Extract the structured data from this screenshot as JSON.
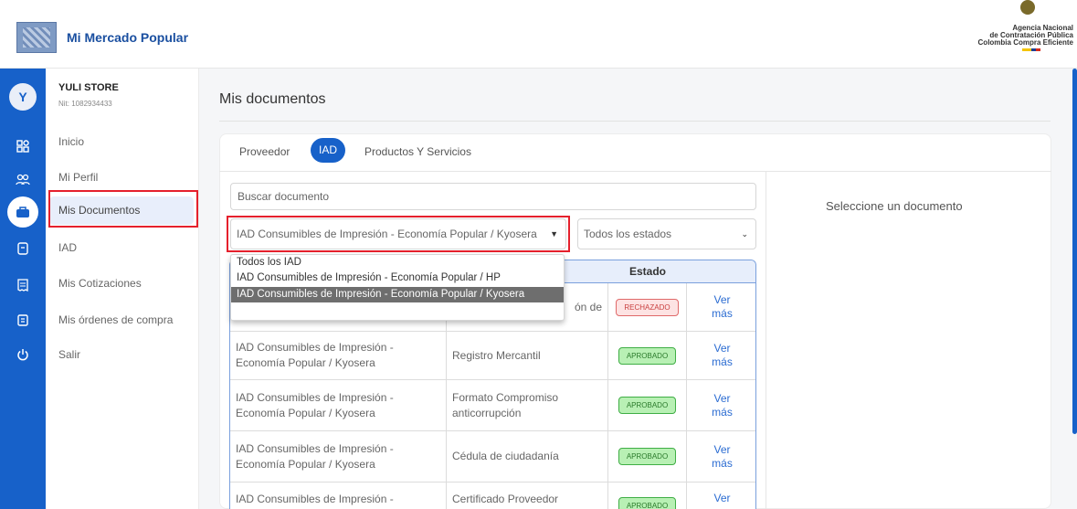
{
  "header": {
    "app_name": "Mi Mercado Popular",
    "agency_line1": "Agencia Nacional",
    "agency_line2": "de Contratación Pública",
    "agency_line3": "Colombia Compra Eficiente"
  },
  "rail": {
    "avatar_letter": "Y",
    "icons": [
      "grid-icon",
      "users-icon",
      "briefcase-icon",
      "document-icon",
      "receipt-icon",
      "clipboard-icon",
      "power-icon"
    ]
  },
  "sidebar": {
    "store_name": "YULI STORE",
    "store_nit": "Nit: 1082934433",
    "items": [
      {
        "label": "Inicio"
      },
      {
        "label": "Mi Perfil"
      },
      {
        "label": "Mis Documentos"
      },
      {
        "label": "IAD"
      },
      {
        "label": "Mis Cotizaciones"
      },
      {
        "label": "Mis órdenes de compra"
      },
      {
        "label": "Salir"
      }
    ],
    "active_index": 2
  },
  "main": {
    "title": "Mis documentos",
    "tabs": [
      {
        "label": "Proveedor"
      },
      {
        "label": "IAD"
      },
      {
        "label": "Productos Y Servicios"
      }
    ],
    "active_tab": 1,
    "search_placeholder": "Buscar documento",
    "iad_select_value": "IAD Consumibles de Impresión - Economía Popular / Kyosera",
    "state_select_value": "Todos los estados",
    "dropdown_options": [
      "Todos los IAD",
      "IAD Consumibles de Impresión - Economía Popular / HP",
      "IAD Consumibles de Impresión - Economía Popular / Kyosera"
    ],
    "dropdown_selected_index": 2,
    "empty_message": "Seleccione un documento"
  },
  "table": {
    "headers": [
      "",
      "",
      "Estado",
      ""
    ],
    "rows": [
      {
        "iad": "",
        "document": "ón de",
        "status": "RECHAZADO",
        "status_type": "rejected",
        "action": "Ver más"
      },
      {
        "iad": "IAD Consumibles de Impresión - Economía Popular / Kyosera",
        "document": "Registro Mercantil",
        "status": "APROBADO",
        "status_type": "approved",
        "action": "Ver más"
      },
      {
        "iad": "IAD Consumibles de Impresión - Economía Popular / Kyosera",
        "document": "Formato Compromiso anticorrupción",
        "status": "APROBADO",
        "status_type": "approved",
        "action": "Ver más"
      },
      {
        "iad": "IAD Consumibles de Impresión - Economía Popular / Kyosera",
        "document": "Cédula de ciudadanía",
        "status": "APROBADO",
        "status_type": "approved",
        "action": "Ver más"
      },
      {
        "iad": "IAD Consumibles de Impresión -",
        "document": "Certificado Proveedor",
        "status": "APROBADO",
        "status_type": "approved",
        "action": "Ver"
      }
    ]
  },
  "colors": {
    "brand_blue": "#1761c9",
    "highlight_red": "#e5202c",
    "approved_green": "#b8f0b4",
    "rejected_red": "#fde3e3"
  }
}
